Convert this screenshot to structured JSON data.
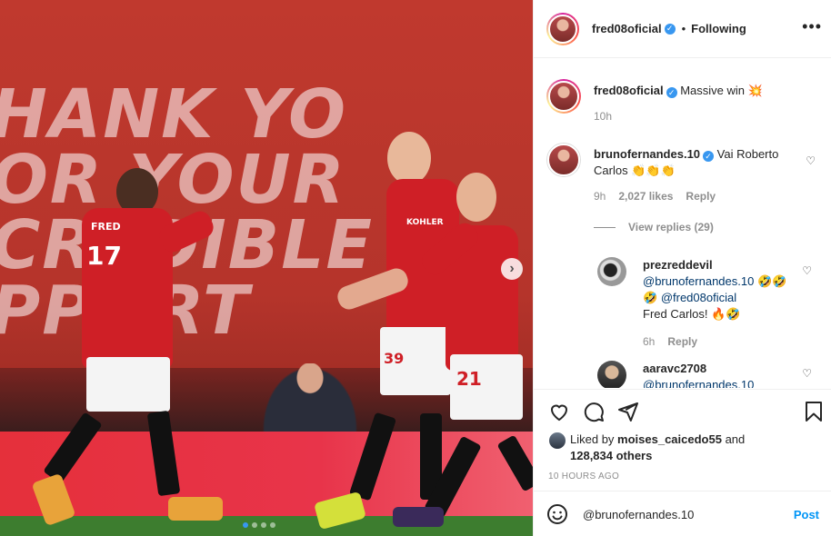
{
  "photo": {
    "banner_text": "HANK YOU\nOR YOUR\nCREDIBLE\nPPORT",
    "player_names": [
      "FRED",
      "",
      ""
    ],
    "player_numbers": [
      "17",
      "39",
      "21"
    ],
    "sponsor": "KOHLER"
  },
  "header": {
    "username": "fred08oficial",
    "separator": "•",
    "following_label": "Following",
    "more_icon": "more-horizontal-icon"
  },
  "caption": {
    "username": "fred08oficial",
    "text": "Massive win 💥",
    "time": "10h"
  },
  "comments": [
    {
      "username": "brunofernandes.10",
      "verified": true,
      "text": "Vai Roberto Carlos 👏👏👏",
      "time": "9h",
      "likes": "2,027 likes",
      "reply_label": "Reply",
      "view_replies": "View replies (29)"
    },
    {
      "username": "prezreddevil",
      "mention1": "@brunofernandes.10",
      "text1": " 🤣🤣🤣 ",
      "mention2": "@fred08oficial",
      "text2": "Fred Carlos! 🔥🤣",
      "time": "6h",
      "reply_label": "Reply"
    },
    {
      "username": "aaravc2708",
      "mention1": "@brunofernandes.10"
    }
  ],
  "actions": {
    "like_icon": "heart-icon",
    "comment_icon": "comment-icon",
    "share_icon": "share-icon",
    "save_icon": "bookmark-icon"
  },
  "likes": {
    "prefix": "Liked by",
    "user": "moises_caicedo55",
    "and": "and",
    "others": "128,834 others"
  },
  "timestamp": "10 HOURS AGO",
  "add_comment": {
    "value": "@brunofernandes.10",
    "post_label": "Post"
  },
  "carousel": {
    "total": 4,
    "active": 1
  },
  "colors": {
    "accent": "#0095f6",
    "verified": "#3897f0",
    "link": "#00376b",
    "muted": "#8e8e8e"
  }
}
